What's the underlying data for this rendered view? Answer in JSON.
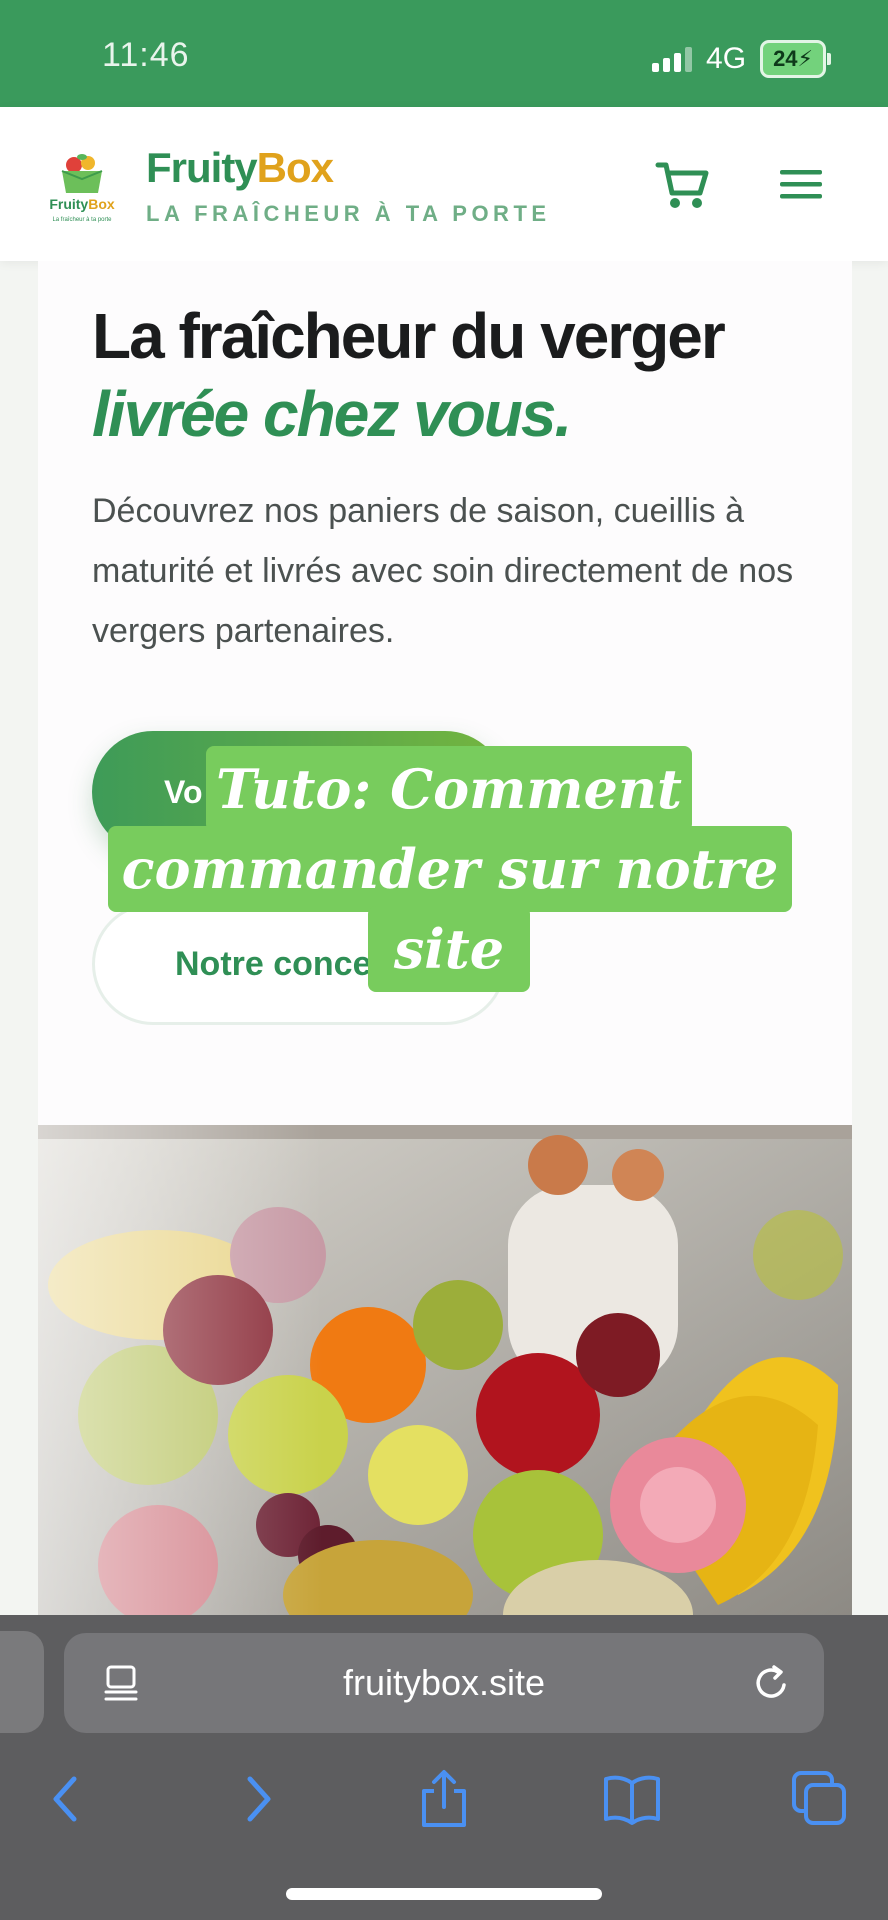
{
  "status_bar": {
    "time": "11:46",
    "network": "4G",
    "battery": "24"
  },
  "header": {
    "logo_text": "FruityBox",
    "logo_subtext": "La fraîcheur à ta porte",
    "brand_name_part1": "Fruity",
    "brand_name_part2": "Box",
    "tagline": "LA FRAÎCHEUR À TA PORTE",
    "icons": [
      "cart-icon",
      "menu-icon"
    ],
    "brand_colors": {
      "green": "#2f8f55",
      "orange": "#e0a21c"
    }
  },
  "hero": {
    "title_line1": "La fraîcheur du verger",
    "title_line2": "livrée chez vous.",
    "description": "Découvrez nos paniers de saison, cueillis à maturité et livrés avec soin directement de nos vergers partenaires.",
    "primary_button_visible_text": "Vo",
    "secondary_button_visible_text": "Notre conce"
  },
  "overlay_caption": {
    "line1": "Tuto: Comment",
    "line2": "commander sur notre",
    "line3": "site",
    "background_color": "#78cc5d"
  },
  "browser": {
    "url": "fruitybox.site",
    "icons": [
      "reader-icon",
      "reload-icon",
      "back-icon",
      "forward-icon",
      "share-icon",
      "bookmarks-icon",
      "tabs-icon"
    ]
  }
}
